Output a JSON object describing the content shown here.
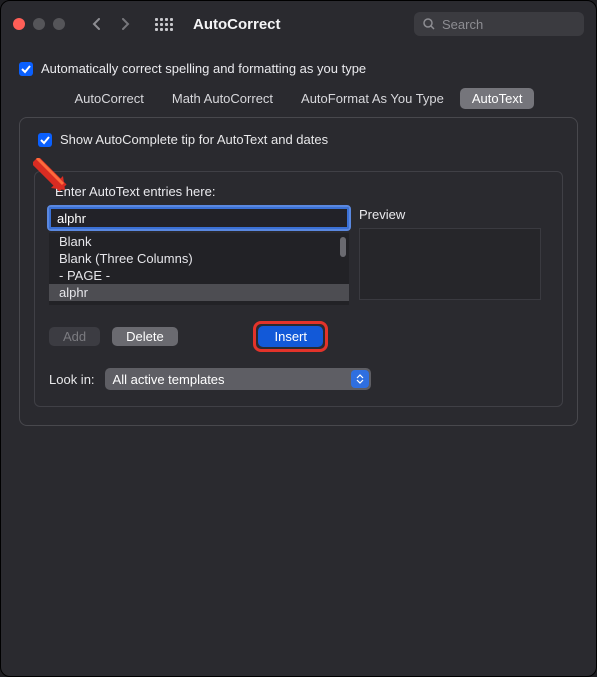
{
  "window": {
    "title": "AutoCorrect",
    "search_placeholder": "Search"
  },
  "main_checkbox": {
    "label": "Automatically correct spelling and formatting as you type",
    "checked": true
  },
  "tabs": [
    {
      "label": "AutoCorrect",
      "active": false
    },
    {
      "label": "Math AutoCorrect",
      "active": false
    },
    {
      "label": "AutoFormat As You Type",
      "active": false
    },
    {
      "label": "AutoText",
      "active": true
    }
  ],
  "autocomplete_checkbox": {
    "label": "Show AutoComplete tip for AutoText and dates",
    "checked": true
  },
  "entry_section": {
    "label": "Enter AutoText entries here:",
    "input_value": "alphr",
    "list": [
      {
        "label": "Blank",
        "selected": false
      },
      {
        "label": "Blank (Three Columns)",
        "selected": false
      },
      {
        "label": "- PAGE -",
        "selected": false
      },
      {
        "label": "alphr",
        "selected": true
      }
    ],
    "preview_label": "Preview"
  },
  "buttons": {
    "add": "Add",
    "delete": "Delete",
    "insert": "Insert"
  },
  "lookin": {
    "label": "Look in:",
    "value": "All active templates"
  },
  "colors": {
    "accent": "#1259d8",
    "highlight_ring": "#e3332a"
  }
}
